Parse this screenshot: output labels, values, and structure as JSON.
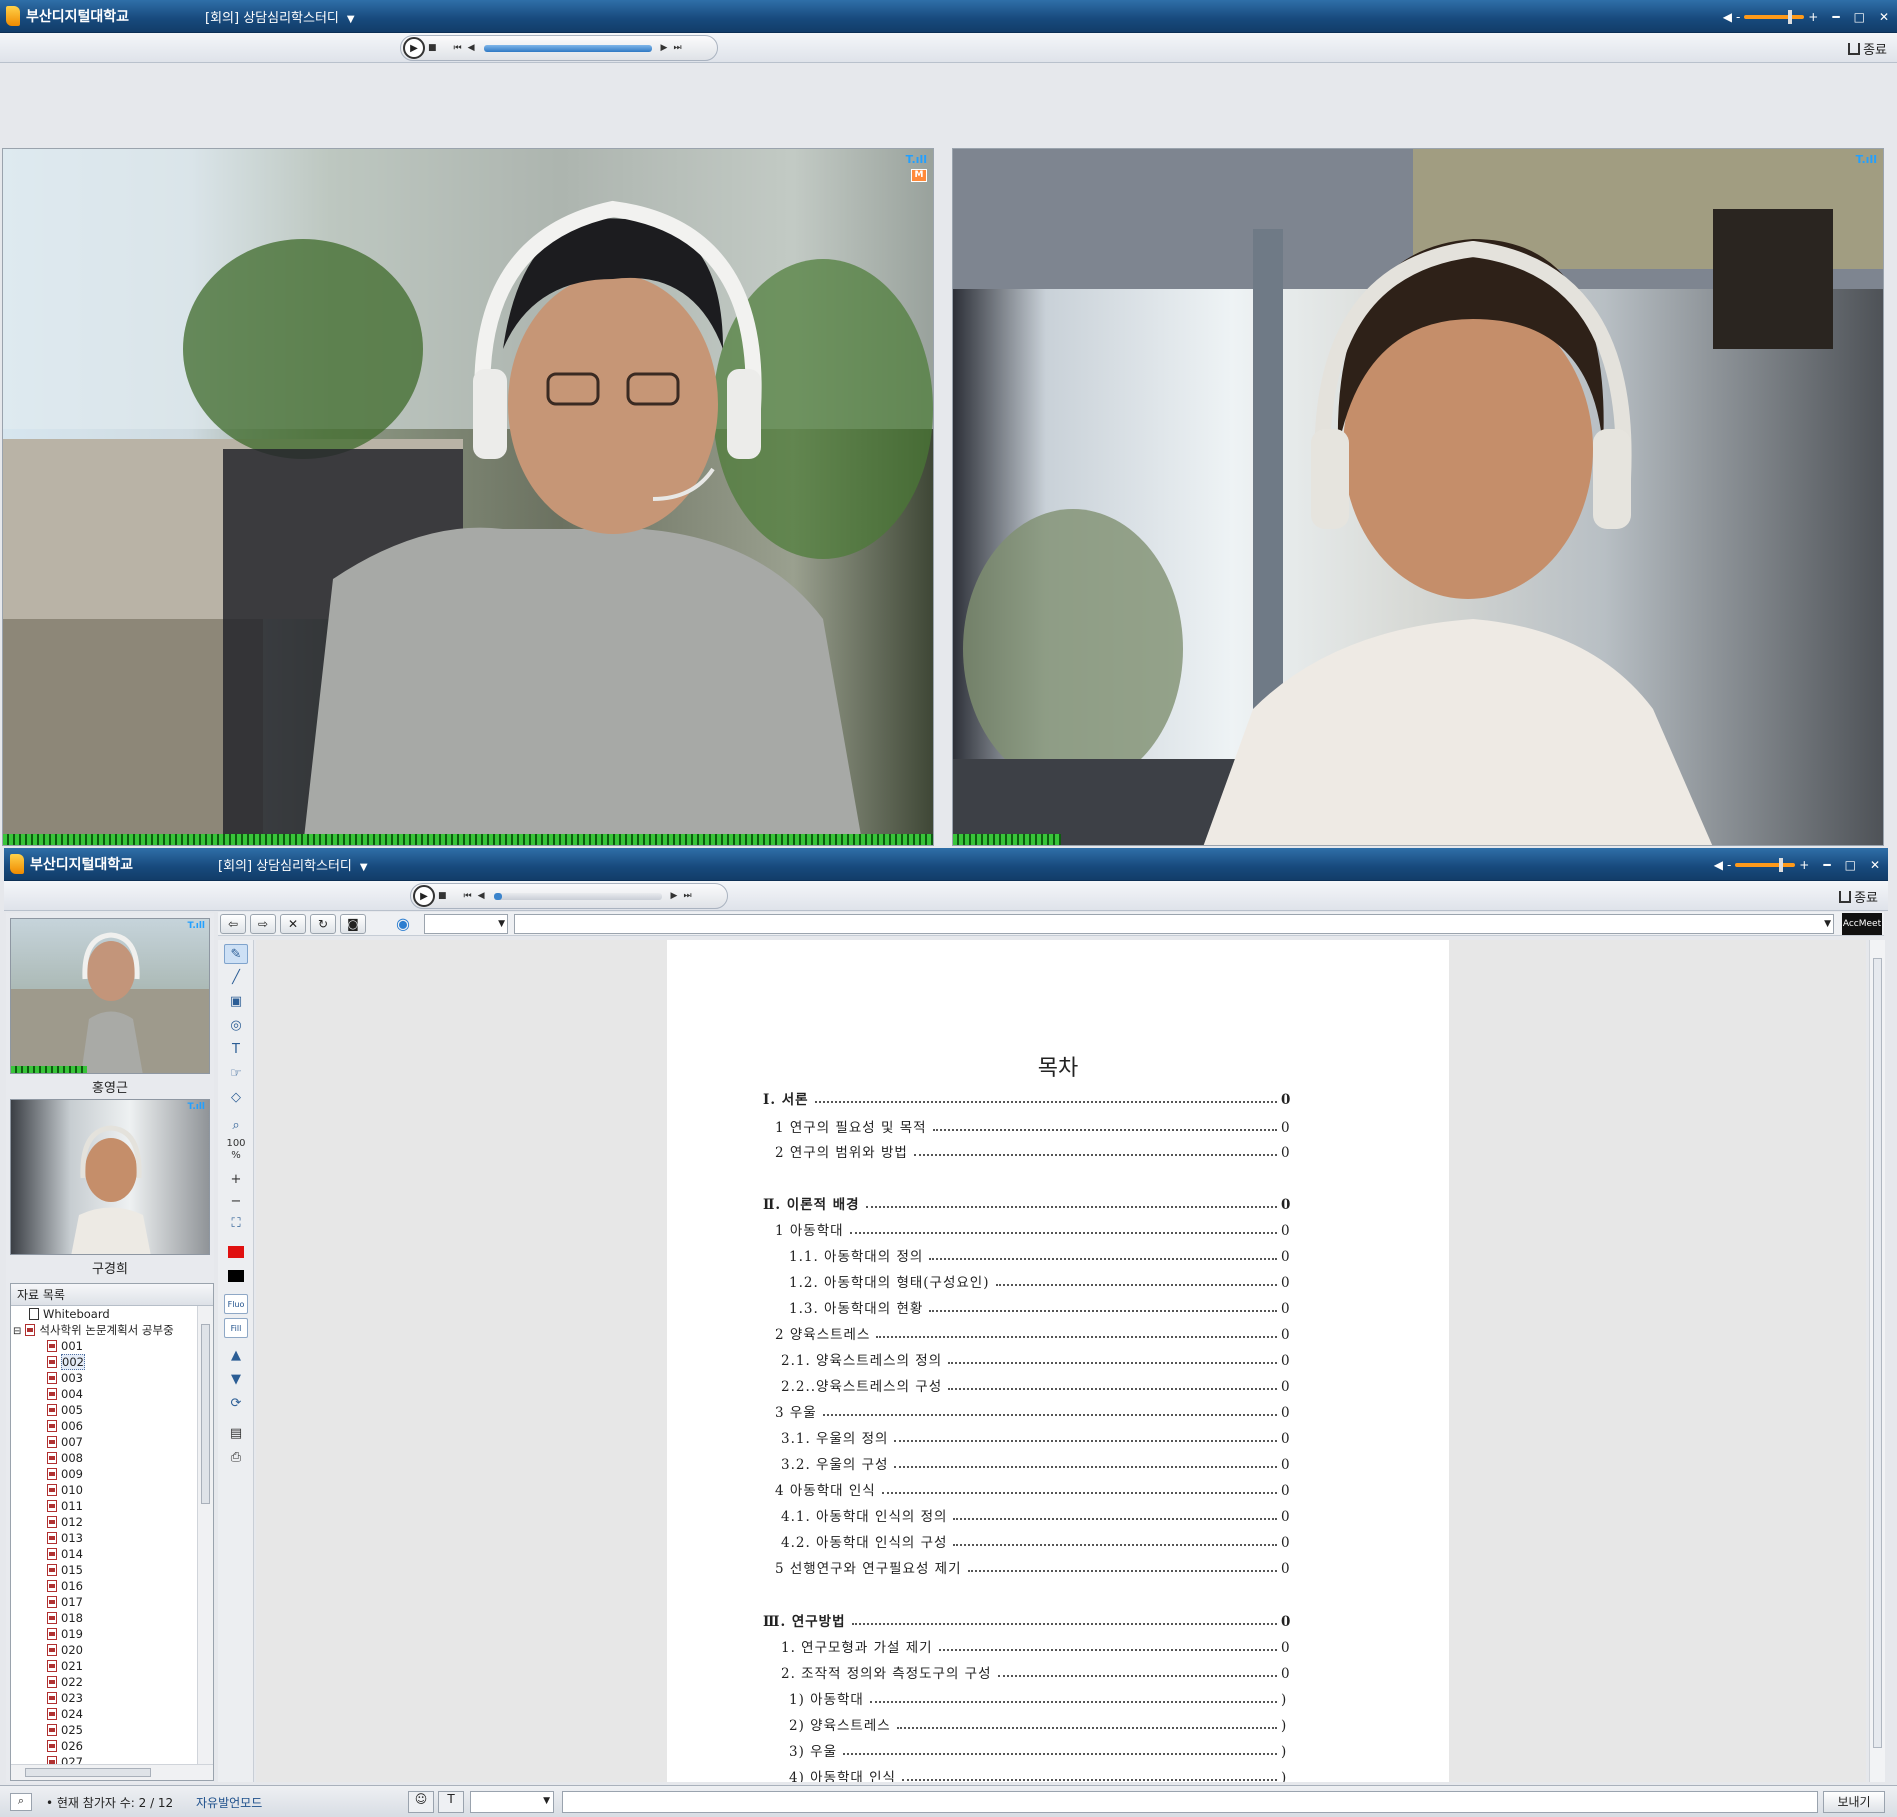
{
  "top_window": {
    "app_name": "부산디지털대학교",
    "room_title": "[회의] 상담심리학스터디",
    "end_label": "종료"
  },
  "bottom_window": {
    "app_name": "부산디지털대학교",
    "room_title": "[회의] 상담심리학스터디",
    "end_label": "종료"
  },
  "participants": [
    {
      "name": "홍영근"
    },
    {
      "name": "구경희"
    }
  ],
  "materials": {
    "header": "자료 목록",
    "items": [
      {
        "label": "Whiteboard",
        "type": "file"
      },
      {
        "label": "석사학위 논문계획서 공부중",
        "type": "folder",
        "expanded": true
      },
      {
        "label": "001"
      },
      {
        "label": "002",
        "selected": true
      },
      {
        "label": "003"
      },
      {
        "label": "004"
      },
      {
        "label": "005"
      },
      {
        "label": "006"
      },
      {
        "label": "007"
      },
      {
        "label": "008"
      },
      {
        "label": "009"
      },
      {
        "label": "010"
      },
      {
        "label": "011"
      },
      {
        "label": "012"
      },
      {
        "label": "013"
      },
      {
        "label": "014"
      },
      {
        "label": "015"
      },
      {
        "label": "016"
      },
      {
        "label": "017"
      },
      {
        "label": "018"
      },
      {
        "label": "019"
      },
      {
        "label": "020"
      },
      {
        "label": "021"
      },
      {
        "label": "022"
      },
      {
        "label": "023"
      },
      {
        "label": "024"
      },
      {
        "label": "025"
      },
      {
        "label": "026"
      },
      {
        "label": "027"
      }
    ]
  },
  "viewer_toolbar": {
    "zoom_label": "100 %",
    "brand": "AccMeet"
  },
  "document": {
    "title": "목차",
    "entries": [
      {
        "label": "Ⅰ. 서론",
        "page": "0",
        "bold": true
      },
      {
        "label": "1 연구의 필요성 및 목적",
        "page": "0"
      },
      {
        "label": "2 연구의 범위와 방법",
        "page": "0"
      },
      {
        "label": "Ⅱ. 이론적 배경",
        "page": "0",
        "bold": true
      },
      {
        "label": "1 아동학대",
        "page": "0"
      },
      {
        "label": "1.1. 아동학대의 정의",
        "page": "0"
      },
      {
        "label": "1.2. 아동학대의 형태(구성요인)",
        "page": "0"
      },
      {
        "label": "1.3. 아동학대의 현황",
        "page": "0"
      },
      {
        "label": "2 양육스트레스",
        "page": "0"
      },
      {
        "label": "2.1. 양육스트레스의 정의",
        "page": "0"
      },
      {
        "label": "2.2..양육스트레스의 구성",
        "page": "0"
      },
      {
        "label": "3 우울",
        "page": "0"
      },
      {
        "label": "3.1. 우울의 정의",
        "page": "0"
      },
      {
        "label": "3.2. 우울의 구성",
        "page": "0"
      },
      {
        "label": "4 아동학대 인식",
        "page": "0"
      },
      {
        "label": "4.1. 아동학대 인식의 정의",
        "page": "0"
      },
      {
        "label": "4.2. 아동학대 인식의 구성",
        "page": "0"
      },
      {
        "label": "5 선행연구와 연구필요성 제기",
        "page": "0"
      },
      {
        "label": "Ⅲ. 연구방법",
        "page": "0",
        "bold": true
      },
      {
        "label": "1. 연구모형과 가설 제기",
        "page": "0"
      },
      {
        "label": "2. 조작적 정의와 측정도구의 구성",
        "page": "0"
      },
      {
        "label": "1) 아동학대",
        "page": ")"
      },
      {
        "label": "2) 양육스트레스",
        "page": ")"
      },
      {
        "label": "3) 우울",
        "page": ")"
      },
      {
        "label": "4) 아동학대 인식",
        "page": ")"
      }
    ]
  },
  "status": {
    "participants_text": "• 현재 참가자 수: 2 / 12",
    "mode": "자유발언모드",
    "send_label": "보내기"
  },
  "colors": {
    "titlebar": "#17497c",
    "accent_orange": "#ff9a1a",
    "vu_green": "#39c43a",
    "pen_red": "#e01010"
  }
}
